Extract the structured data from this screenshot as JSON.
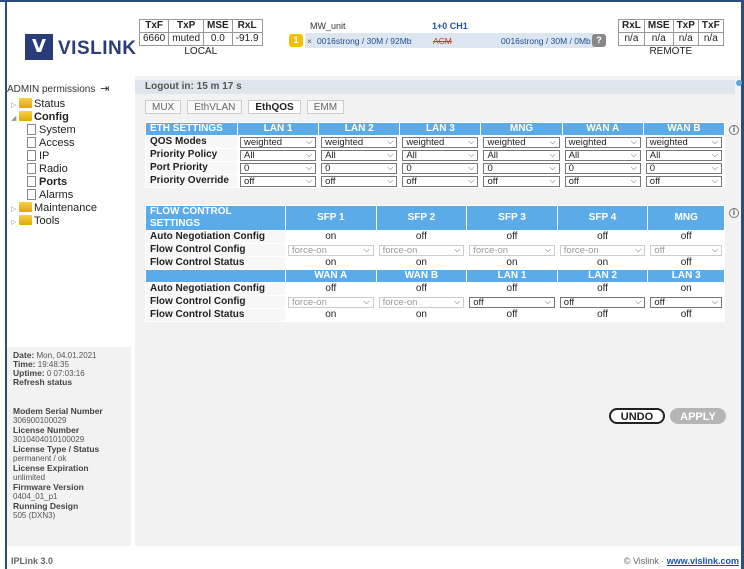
{
  "logo": {
    "mark": "V",
    "text": "VISLINK"
  },
  "local": {
    "headers": [
      "TxF",
      "TxP",
      "MSE",
      "RxL"
    ],
    "values": [
      "6660",
      "muted",
      "0.0",
      "-91.9"
    ],
    "caption": "LOCAL"
  },
  "remote": {
    "headers": [
      "RxL",
      "MSE",
      "TxP",
      "TxF"
    ],
    "values": [
      "n/a",
      "n/a",
      "n/a",
      "n/a"
    ],
    "caption": "REMOTE"
  },
  "mw": {
    "unit": "MW_unit",
    "channel": "1+0 CH1",
    "badge": "1",
    "x_mark": "×",
    "local_link": "0016strong / 30M / 92Mb",
    "acm": "ACM",
    "remote_link": "0016strong / 30M / 0Mb",
    "help_badge": "?"
  },
  "sidebar": {
    "admin": "ADMIN permissions",
    "tree": [
      {
        "label": "Status",
        "type": "folder",
        "tri": "▷",
        "level": 0,
        "bold": false
      },
      {
        "label": "Config",
        "type": "folder",
        "tri": "◢",
        "level": 0,
        "bold": true
      },
      {
        "label": "System",
        "type": "doc",
        "level": 1,
        "bold": false
      },
      {
        "label": "Access",
        "type": "doc",
        "level": 1,
        "bold": false
      },
      {
        "label": "IP",
        "type": "doc",
        "level": 1,
        "bold": false
      },
      {
        "label": "Radio",
        "type": "doc",
        "level": 1,
        "bold": false
      },
      {
        "label": "Ports",
        "type": "doc",
        "level": 1,
        "bold": true
      },
      {
        "label": "Alarms",
        "type": "doc",
        "level": 1,
        "bold": false
      },
      {
        "label": "Maintenance",
        "type": "folder",
        "tri": "▷",
        "level": 0,
        "bold": false
      },
      {
        "label": "Tools",
        "type": "folder",
        "tri": "▷",
        "level": 0,
        "bold": false
      }
    ],
    "date_label": "Date:",
    "date_value": "Mon, 04.01.2021",
    "time_label": "Time:",
    "time_value": "19:48:35",
    "uptime_label": "Uptime:",
    "uptime_value": "0 07:03:16",
    "refresh": "Refresh status",
    "serial_label": "Modem Serial Number",
    "serial_value": "306900100029",
    "license_label": "License Number",
    "license_value": "3010404010100029",
    "ltype_label": "License Type / Status",
    "ltype_value": "permanent / ok",
    "lexp_label": "License Expiration",
    "lexp_value": "unlimited",
    "fw_label": "Firmware Version",
    "fw_value": "0404_01_p1",
    "design_label": "Running Design",
    "design_value": "505 (DXN3)"
  },
  "main": {
    "logout": "Logout in: 15 m 17 s",
    "tabs": [
      "MUX",
      "EthVLAN",
      "EthQOS",
      "EMM"
    ],
    "eth": {
      "title": "ETH SETTINGS",
      "cols": [
        "LAN 1",
        "LAN 2",
        "LAN 3",
        "MNG",
        "WAN A",
        "WAN B"
      ],
      "rows": [
        {
          "label": "QOS Modes",
          "vals": [
            "weighted",
            "weighted",
            "weighted",
            "weighted",
            "weighted",
            "weighted"
          ]
        },
        {
          "label": "Priority Policy",
          "vals": [
            "All",
            "All",
            "All",
            "All",
            "All",
            "All"
          ]
        },
        {
          "label": "Port Priority",
          "vals": [
            "0",
            "0",
            "0",
            "0",
            "0",
            "0"
          ]
        },
        {
          "label": "Priority Override",
          "vals": [
            "off",
            "off",
            "off",
            "off",
            "off",
            "off"
          ]
        }
      ]
    },
    "flow": {
      "title": "FLOW CONTROL SETTINGS",
      "cols": [
        "SFP 1",
        "SFP 2",
        "SFP 3",
        "SFP 4",
        "MNG"
      ],
      "auto_label": "Auto Negotiation Config",
      "auto": [
        "on",
        "off",
        "off",
        "off",
        "off"
      ],
      "cfg_label": "Flow Control Config",
      "cfg": [
        "force-on",
        "force-on",
        "force-on",
        "force-on",
        "off"
      ],
      "status_label": "Flow Control Status",
      "status": [
        "on",
        "on",
        "on",
        "on",
        "off"
      ],
      "cols2": [
        "WAN A",
        "WAN B",
        "LAN 1",
        "LAN 2",
        "LAN 3"
      ],
      "auto2": [
        "off",
        "off",
        "off",
        "off",
        "on"
      ],
      "cfg2": [
        "force-on",
        "force-on",
        "off",
        "off",
        "off"
      ],
      "status2": [
        "on",
        "on",
        "off",
        "off",
        "off"
      ]
    },
    "undo": "UNDO",
    "apply": "APPLY"
  },
  "footer": {
    "version": "IPLink 3.0",
    "copyright": "© Vislink · ",
    "link": "www.vislink.com"
  }
}
